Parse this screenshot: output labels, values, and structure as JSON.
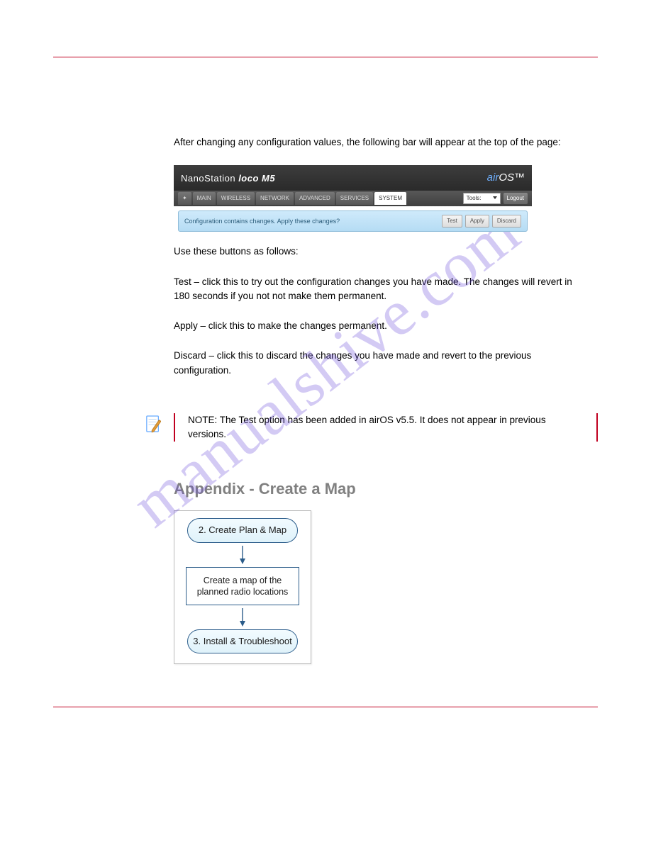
{
  "watermark": "manualshive.com",
  "intro": {
    "para": "After changing any configuration values, the following bar will appear at the top of the page:"
  },
  "screenshot": {
    "brand_prefix": "NanoStation",
    "brand_model": "loco M5",
    "airos_air": "air",
    "airos_os": "OS",
    "tabs": {
      "main": "MAIN",
      "wireless": "WIRELESS",
      "network": "NETWORK",
      "advanced": "ADVANCED",
      "services": "SERVICES",
      "system": "SYSTEM"
    },
    "tools_label": "Tools:",
    "logout": "Logout",
    "bar_message": "Configuration contains changes. Apply these changes?",
    "buttons": {
      "test": "Test",
      "apply": "Apply",
      "discard": "Discard"
    }
  },
  "buttons_para": "Use these buttons as follows:",
  "bullets": {
    "test": "Test – click this to try out the configuration changes you have made. The changes will revert in 180 seconds if you not not make them permanent.",
    "apply": "Apply – click this to make the changes permanent.",
    "discard": "Discard – click this to discard the changes you have made and revert to the previous configuration."
  },
  "note": {
    "text": "NOTE: The Test option has been added in airOS v5.5. It does not appear in previous versions."
  },
  "heading": "Appendix - Create a Map",
  "flow": {
    "step2": "2. Create Plan & Map",
    "mid": "Create a map of the planned radio locations",
    "step3": "3. Install & Troubleshoot"
  }
}
